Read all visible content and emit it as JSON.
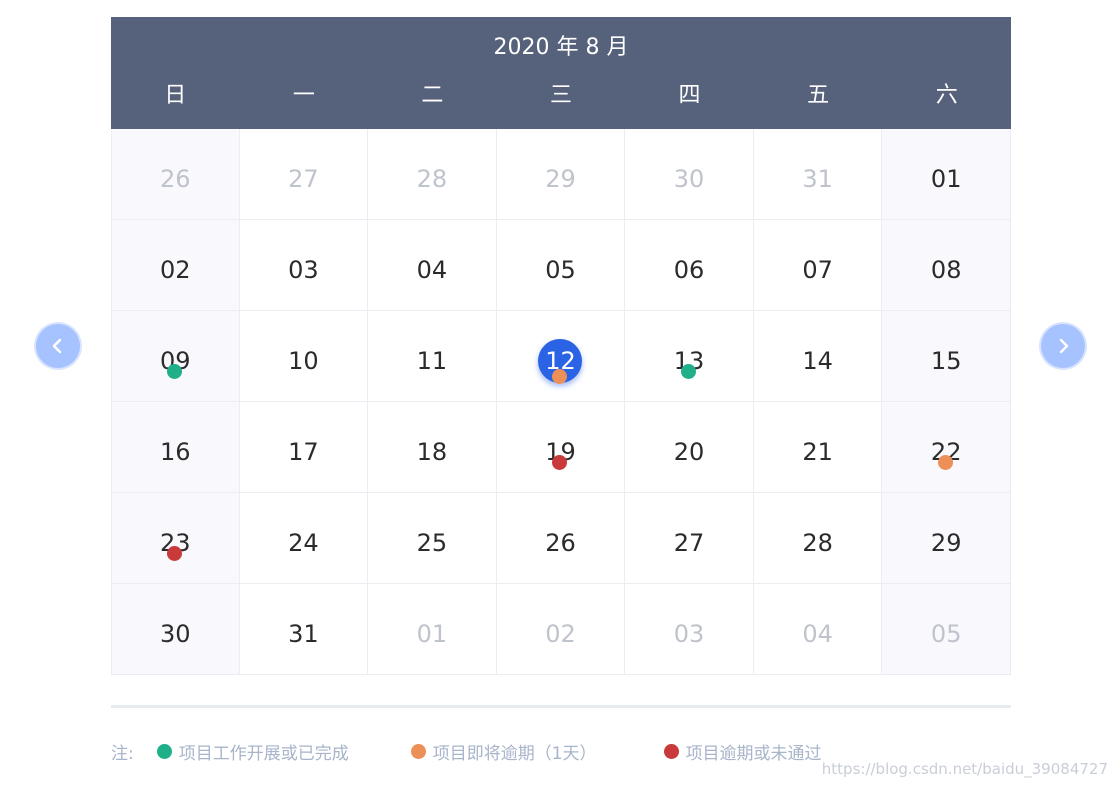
{
  "calendar": {
    "title": "2020 年 8 月",
    "weekdays": [
      "日",
      "一",
      "二",
      "三",
      "四",
      "五",
      "六"
    ],
    "weeks": [
      [
        {
          "day": "26",
          "other": true
        },
        {
          "day": "27",
          "other": true
        },
        {
          "day": "28",
          "other": true
        },
        {
          "day": "29",
          "other": true
        },
        {
          "day": "30",
          "other": true
        },
        {
          "day": "31",
          "other": true
        },
        {
          "day": "01"
        }
      ],
      [
        {
          "day": "02"
        },
        {
          "day": "03"
        },
        {
          "day": "04"
        },
        {
          "day": "05"
        },
        {
          "day": "06"
        },
        {
          "day": "07"
        },
        {
          "day": "08"
        }
      ],
      [
        {
          "day": "09",
          "status": "green"
        },
        {
          "day": "10"
        },
        {
          "day": "11"
        },
        {
          "day": "12",
          "today": true,
          "status": "orange"
        },
        {
          "day": "13",
          "status": "green"
        },
        {
          "day": "14"
        },
        {
          "day": "15"
        }
      ],
      [
        {
          "day": "16"
        },
        {
          "day": "17"
        },
        {
          "day": "18"
        },
        {
          "day": "19",
          "status": "red"
        },
        {
          "day": "20"
        },
        {
          "day": "21"
        },
        {
          "day": "22",
          "status": "orange"
        }
      ],
      [
        {
          "day": "23",
          "status": "red"
        },
        {
          "day": "24"
        },
        {
          "day": "25"
        },
        {
          "day": "26"
        },
        {
          "day": "27"
        },
        {
          "day": "28"
        },
        {
          "day": "29"
        }
      ],
      [
        {
          "day": "30"
        },
        {
          "day": "31"
        },
        {
          "day": "01",
          "other": true
        },
        {
          "day": "02",
          "other": true
        },
        {
          "day": "03",
          "other": true
        },
        {
          "day": "04",
          "other": true
        },
        {
          "day": "05",
          "other": true
        }
      ]
    ]
  },
  "colors": {
    "green": "#1fb08a",
    "orange": "#ed9058",
    "red": "#c93a3a",
    "header_bg": "#56617c",
    "today": "#2a63e4",
    "nav_button": "#a6c3ff"
  },
  "navigation": {
    "prev_icon": "chevron-left-icon",
    "next_icon": "chevron-right-icon"
  },
  "legend": {
    "label": "注:",
    "items": [
      {
        "color": "green",
        "text": "项目工作开展或已完成"
      },
      {
        "color": "orange",
        "text": "项目即将逾期（1天）"
      },
      {
        "color": "red",
        "text": "项目逾期或未通过"
      }
    ]
  },
  "watermark": "https://blog.csdn.net/baidu_39084727"
}
